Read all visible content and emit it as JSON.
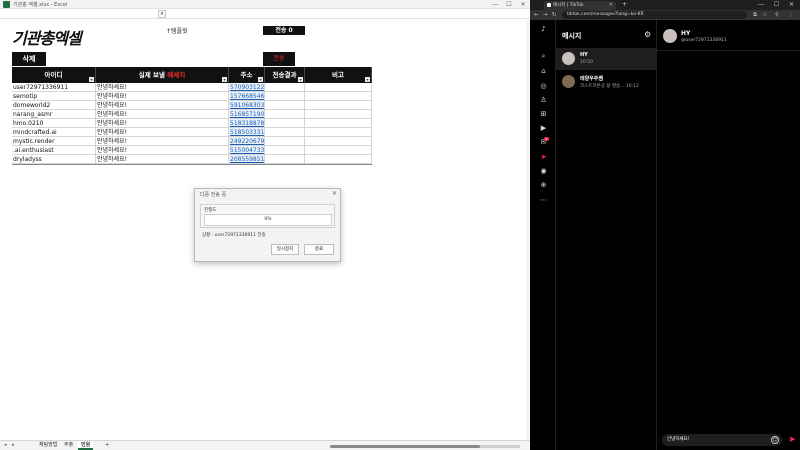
{
  "excel": {
    "window_title": "기관총 엑셀.xlsx - Excel",
    "window_min": "—",
    "window_max": "☐",
    "window_close": "✕",
    "formula_dropdown": "▾",
    "logo": "기관총엑셀",
    "template_label": "↑템플릿",
    "send_count_label": "전송 0",
    "delete_button": "삭제",
    "send_button": "전송",
    "columns": {
      "id": "아이디",
      "message_prefix": "실제 보낼 ",
      "message_suffix": "메세지",
      "address": "주소",
      "result": "전송결과",
      "note": "비고"
    },
    "filter_glyph": "▾",
    "rows": [
      {
        "id": "user72971336911",
        "message": "안녕하세요!",
        "address": "57090312208"
      },
      {
        "id": "semotip",
        "message": "안녕하세요!",
        "address": "15766854677"
      },
      {
        "id": "domeworld2",
        "message": "안녕하세요!",
        "address": "59106830338"
      },
      {
        "id": "narang_asmr",
        "message": "안녕하세요!",
        "address": "51685719042"
      },
      {
        "id": "hmo.0210",
        "message": "안녕하세요!",
        "address": "51831887877"
      },
      {
        "id": "mindcrafted.ai",
        "message": "안녕하세요!",
        "address": "51850333189"
      },
      {
        "id": "mystic.render",
        "message": "안녕하세요!",
        "address": "24922067990"
      },
      {
        "id": ".ai.enthusiast",
        "message": "안녕하세요!",
        "address": "51500473326"
      },
      {
        "id": "dryladyss",
        "message": "안녕하세요!",
        "address": "20855985172"
      }
    ],
    "sheet_tabs": [
      "채팅방법",
      "주출",
      "인원"
    ],
    "active_tab": 2,
    "add_sheet": "+",
    "nav_prev": "◂",
    "nav_next": "▸"
  },
  "dialog": {
    "title": "다중 전송 중",
    "close": "✕",
    "group_label": "진행도",
    "progress_percent": 0,
    "progress_text": "0%",
    "status": "상황 :      user72971336911 전송",
    "pause_button": "일시정지",
    "stop_button": "종료"
  },
  "browser": {
    "tab_label": "메시지 | TikTok",
    "tab_close": "✕",
    "new_tab": "+",
    "win_min": "—",
    "win_max": "☐",
    "win_close": "✕",
    "nav_back": "←",
    "nav_forward": "→",
    "nav_reload": "↻",
    "url": "tiktok.com/messages?lang=ko-KR",
    "ext_icons": [
      "⧉",
      "☆",
      "⚲",
      "⋮"
    ]
  },
  "tiktok": {
    "rail_icons": [
      "♪",
      "⌕",
      "⌂",
      "◎",
      "♙",
      "⊞",
      "▶",
      "✉",
      "➤",
      "◉",
      "⊕",
      "⋯"
    ],
    "rail_badge": "1",
    "list_title": "메시지",
    "gear": "⚙",
    "conversations": [
      {
        "name": "HY",
        "sub": "10:50",
        "active": true
      },
      {
        "name": "태양우주쌤",
        "sub": "코스트코몬상 왕 맨송... 10:12",
        "active": false
      }
    ],
    "chat_name": "HY",
    "chat_handle": "@user72971336911",
    "message_input": "안녕하세요!",
    "emoji_icon": "☺",
    "send_icon": "➤"
  }
}
